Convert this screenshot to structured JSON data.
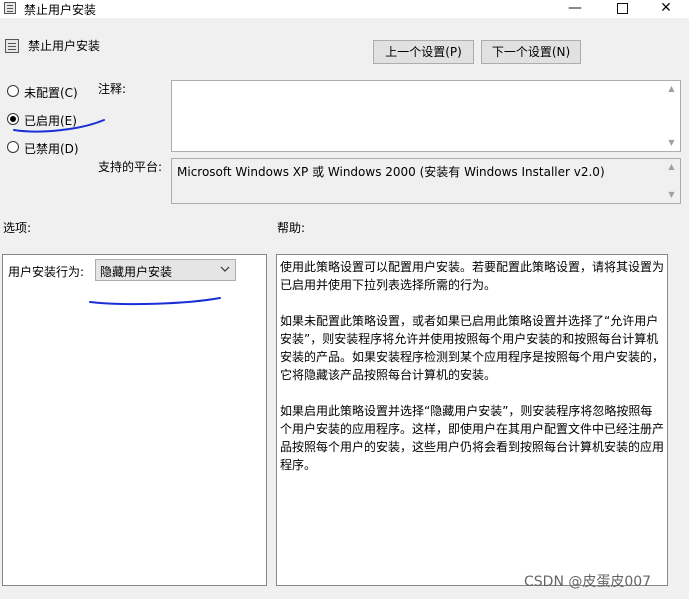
{
  "window": {
    "title": "禁止用户安装",
    "min_glyph": "—",
    "close_glyph": "✕"
  },
  "header": {
    "policy_title": "禁止用户安装",
    "prev_button": "上一个设置(P)",
    "next_button": "下一个设置(N)"
  },
  "state": {
    "options": [
      {
        "label": "未配置(C)",
        "checked": false
      },
      {
        "label": "已启用(E)",
        "checked": true
      },
      {
        "label": "已禁用(D)",
        "checked": false
      }
    ]
  },
  "comment": {
    "label": "注释:",
    "value": ""
  },
  "platform": {
    "label": "支持的平台:",
    "value": "Microsoft Windows XP 或 Windows 2000 (安装有 Windows Installer v2.0)"
  },
  "options_section": {
    "heading": "选项:",
    "field_label": "用户安装行为:",
    "dropdown_value": "隐藏用户安装"
  },
  "help_section": {
    "heading": "帮助:",
    "paragraphs": [
      "使用此策略设置可以配置用户安装。若要配置此策略设置，请将其设置为已启用并使用下拉列表选择所需的行为。",
      "如果未配置此策略设置，或者如果已启用此策略设置并选择了“允许用户安装”，则安装程序将允许并使用按照每个用户安装的和按照每台计算机安装的产品。如果安装程序检测到某个应用程序是按照每个用户安装的，它将隐藏该产品按照每台计算机的安装。",
      "如果启用此策略设置并选择“隐藏用户安装”，则安装程序将忽略按照每个用户安装的应用程序。这样，即使用户在其用户配置文件中已经注册产品按照每个用户的安装，这些用户仍将会看到按照每台计算机安装的应用程序。"
    ]
  },
  "colors": {
    "annotation": "#1a2fd6",
    "background": "#f0f0f0"
  },
  "watermark": "CSDN @皮蛋皮007"
}
